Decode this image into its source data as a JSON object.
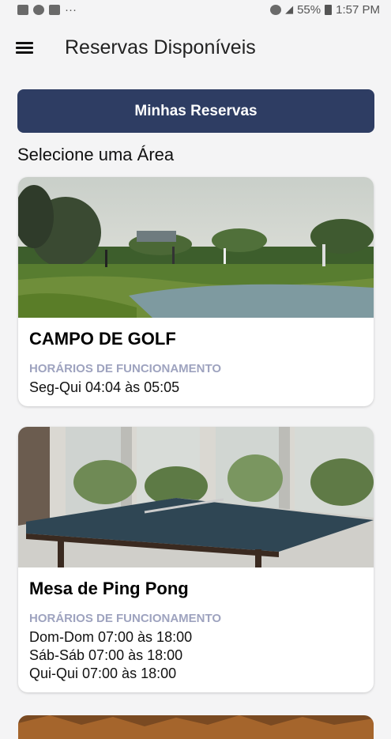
{
  "status_bar": {
    "more": "···",
    "battery": "55%",
    "time": "1:57 PM"
  },
  "app_bar": {
    "title": "Reservas Disponíveis"
  },
  "my_reservations_button": "Minhas Reservas",
  "select_area_label": "Selecione uma Área",
  "areas": [
    {
      "name": "CAMPO DE GOLF",
      "hours_label": "HORÁRIOS DE FUNCIONAMENTO",
      "hours": [
        "Seg-Qui 04:04 às 05:05"
      ]
    },
    {
      "name": "Mesa de Ping Pong",
      "hours_label": "HORÁRIOS DE FUNCIONAMENTO",
      "hours": [
        "Dom-Dom 07:00 às 18:00",
        "Sáb-Sáb 07:00 às 18:00",
        "Qui-Qui 07:00 às 18:00"
      ]
    }
  ],
  "colors": {
    "primary": "#2e3d63",
    "hours_label": "#9ea3bf",
    "background": "#f4f4f5"
  }
}
